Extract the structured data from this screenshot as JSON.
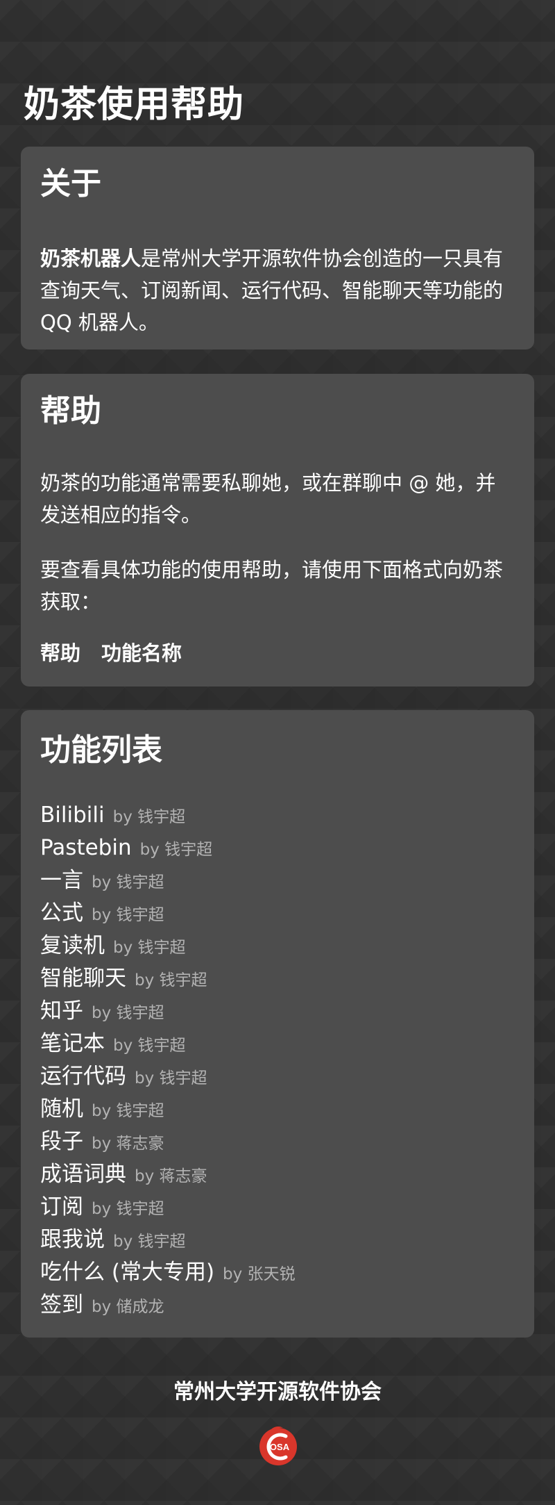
{
  "page": {
    "title": "奶茶使用帮助"
  },
  "about": {
    "title": "关于",
    "bot_name": "奶茶机器人",
    "description": "是常州大学开源软件协会创造的一只具有查询天气、订阅新闻、运行代码、智能聊天等功能的 QQ 机器人。"
  },
  "help": {
    "title": "帮助",
    "paragraph1": "奶茶的功能通常需要私聊她，或在群聊中 @ 她，并发送相应的指令。",
    "paragraph2": "要查看具体功能的使用帮助，请使用下面格式向奶茶获取：",
    "command_keyword": "帮助",
    "command_arg": "功能名称"
  },
  "features": {
    "title": "功能列表",
    "items": [
      {
        "name": "Bilibili",
        "by": "by 钱宇超"
      },
      {
        "name": "Pastebin",
        "by": "by 钱宇超"
      },
      {
        "name": "一言",
        "by": "by 钱宇超"
      },
      {
        "name": "公式",
        "by": "by 钱宇超"
      },
      {
        "name": "复读机",
        "by": "by 钱宇超"
      },
      {
        "name": "智能聊天",
        "by": "by 钱宇超"
      },
      {
        "name": "知乎",
        "by": "by 钱宇超"
      },
      {
        "name": "笔记本",
        "by": "by 钱宇超"
      },
      {
        "name": "运行代码",
        "by": "by 钱宇超"
      },
      {
        "name": "随机",
        "by": "by 钱宇超"
      },
      {
        "name": "段子",
        "by": "by 蒋志豪"
      },
      {
        "name": "成语词典",
        "by": "by 蒋志豪"
      },
      {
        "name": "订阅",
        "by": "by 钱宇超"
      },
      {
        "name": "跟我说",
        "by": "by 钱宇超"
      },
      {
        "name": "吃什么 (常大专用)",
        "by": "by 张天锐"
      },
      {
        "name": "签到",
        "by": "by 储成龙"
      }
    ]
  },
  "footer": {
    "org_name": "常州大学开源软件协会",
    "logo_text": "OSA",
    "logo_icon": "osa-logo-icon",
    "colors": {
      "logo_red": "#d9362b",
      "card_bg": "#4d4d4d",
      "page_bg": "#2f2f2f"
    }
  }
}
